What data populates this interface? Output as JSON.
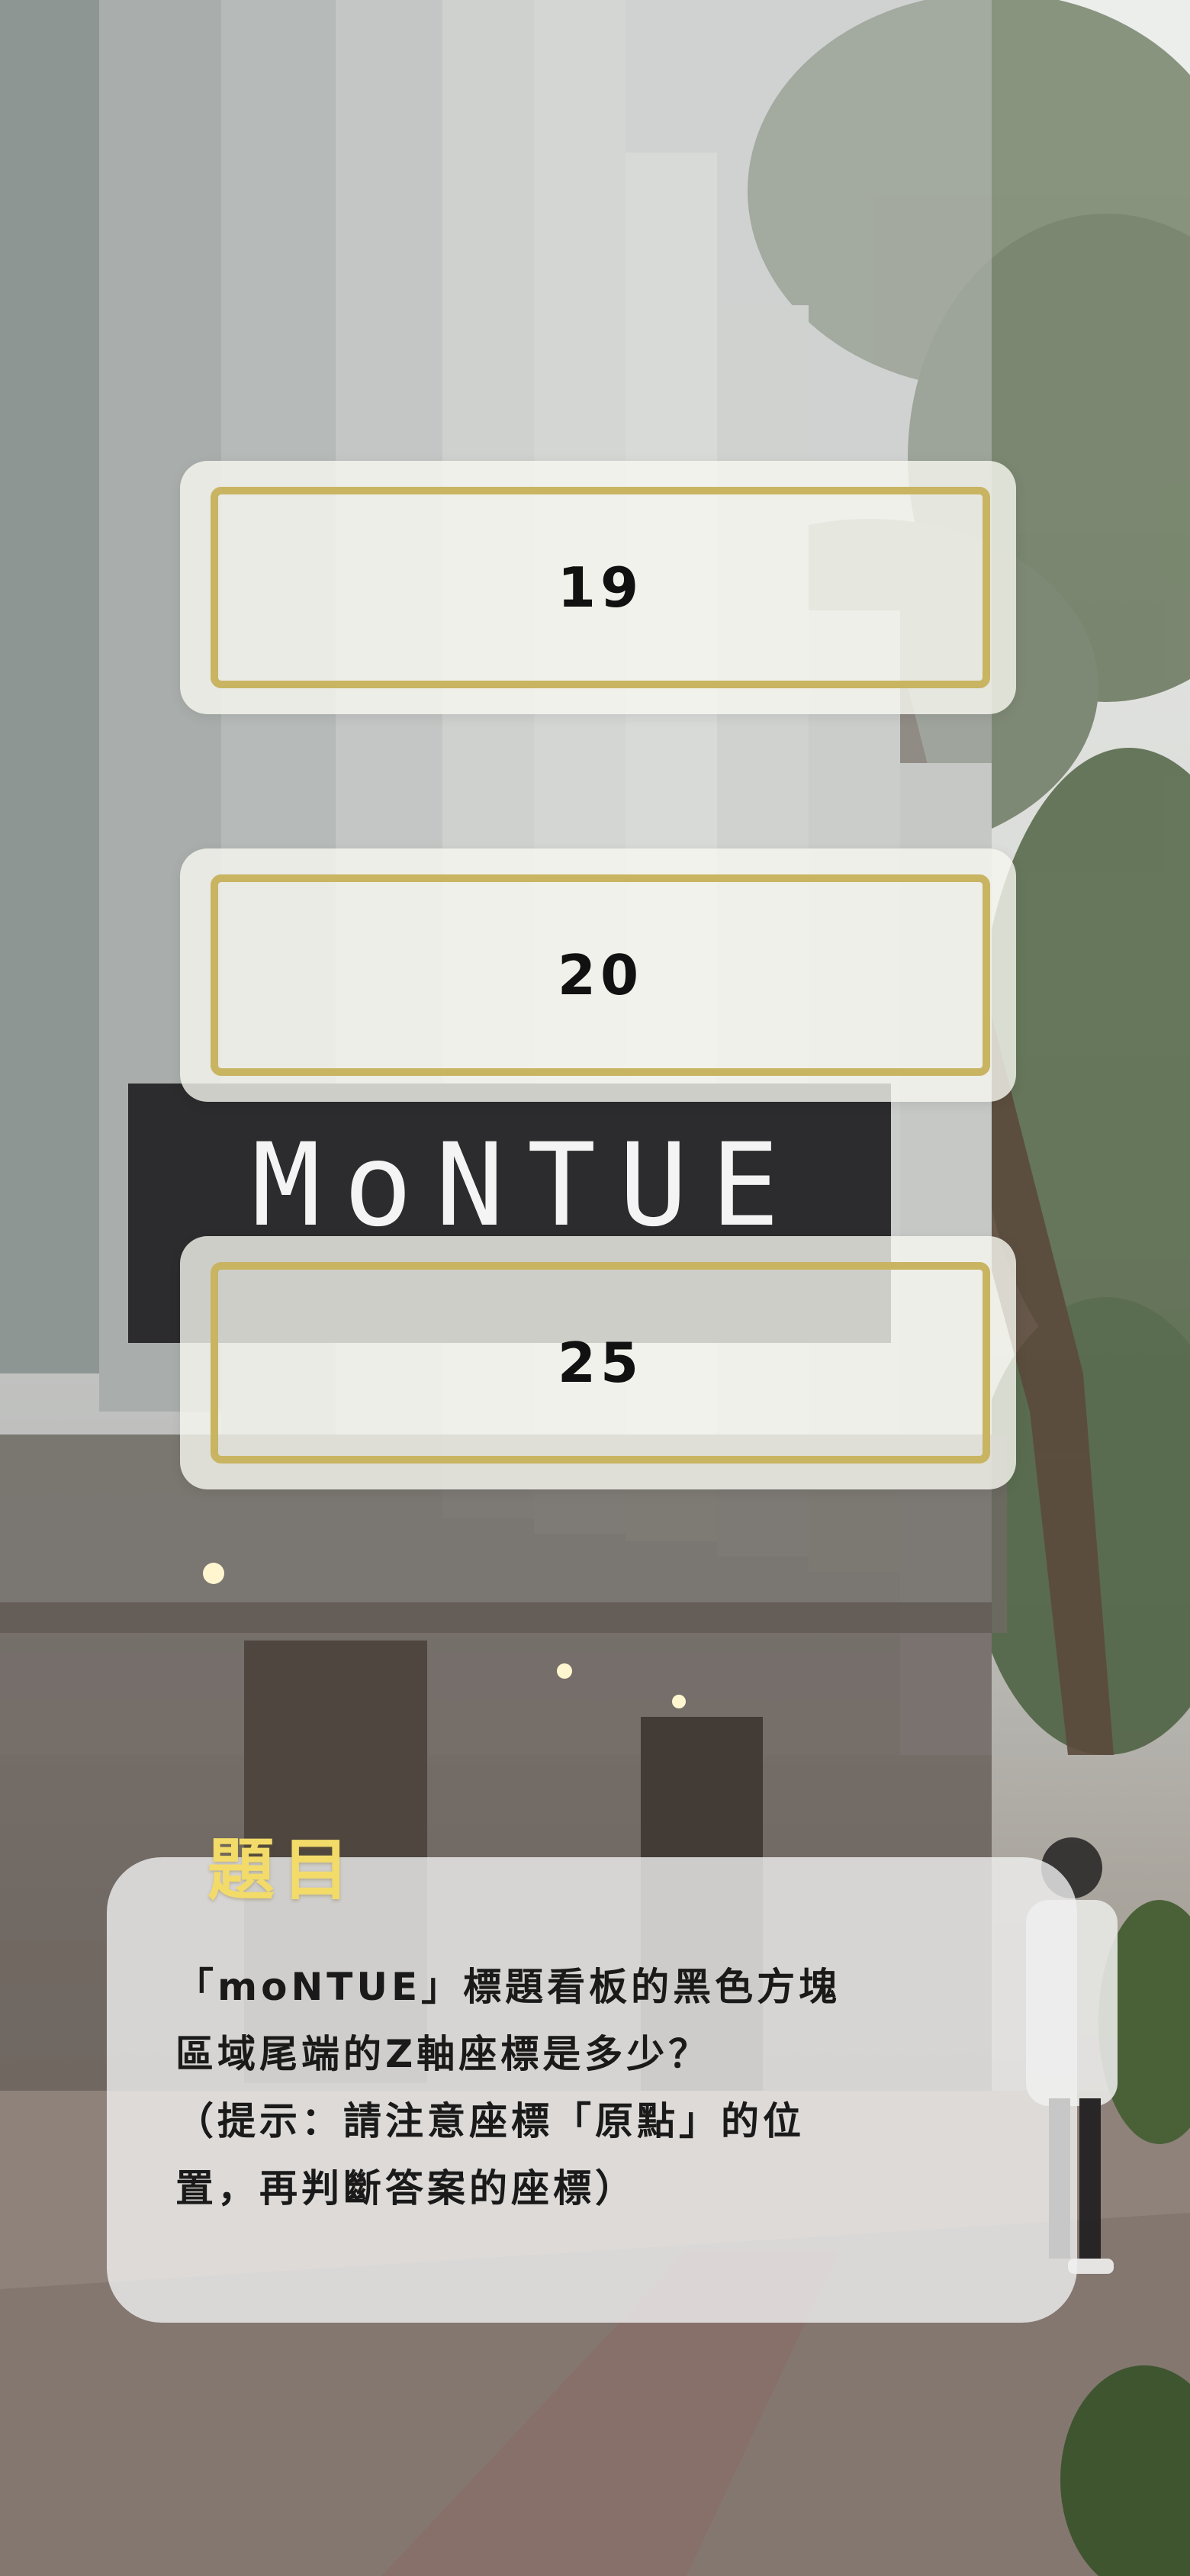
{
  "answers": [
    {
      "label": "19"
    },
    {
      "label": "20"
    },
    {
      "label": "25"
    }
  ],
  "question": {
    "heading": "題目",
    "text": "「moNTUE」標題看板的黑色方塊\n區域尾端的Z軸座標是多少？\n（提示：請注意座標「原點」的位\n置，再判斷答案的座標）"
  },
  "background": {
    "sign_text": "MoNTUE",
    "accent_color": "#c9b462",
    "heading_color": "#f3db6a"
  }
}
